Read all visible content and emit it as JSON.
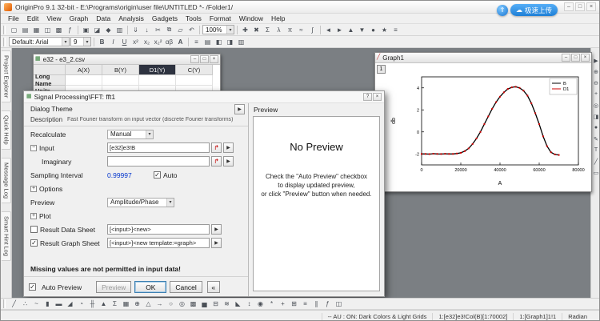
{
  "titlebar": {
    "app_title": "OriginPro 9.1 32-bit - E:\\Programs\\origin\\user file\\UNTITLED *- /Folder1/",
    "upload_button": "极速上传"
  },
  "menubar": {
    "items": [
      "File",
      "Edit",
      "View",
      "Graph",
      "Data",
      "Analysis",
      "Gadgets",
      "Tools",
      "Format",
      "Window",
      "Help"
    ]
  },
  "toolbar_main": {
    "zoom_value": "100%",
    "icons1": [
      {
        "name": "new-project-icon",
        "g": "▢"
      },
      {
        "name": "new-folder-icon",
        "g": "▤"
      },
      {
        "name": "new-workbook-icon",
        "g": "▦"
      },
      {
        "name": "new-graph-icon",
        "g": "◫"
      },
      {
        "name": "new-matrix-icon",
        "g": "▩"
      },
      {
        "name": "new-function-icon",
        "g": "ƒ"
      }
    ],
    "icons2": [
      {
        "name": "open-icon",
        "g": "▣"
      },
      {
        "name": "open-template-icon",
        "g": "◪"
      },
      {
        "name": "save-project-icon",
        "g": "◆"
      },
      {
        "name": "print-icon",
        "g": "▥"
      }
    ],
    "icons3": [
      {
        "name": "import-wizard-icon",
        "g": "⇓"
      },
      {
        "name": "import-ascii-icon",
        "g": "↓"
      },
      {
        "name": "cut-icon",
        "g": "✂"
      },
      {
        "name": "copy-icon",
        "g": "⧉"
      },
      {
        "name": "paste-icon",
        "g": "▱"
      },
      {
        "name": "undo-icon",
        "g": "↶"
      }
    ],
    "icons4": [
      {
        "name": "add-icon",
        "g": "✚"
      },
      {
        "name": "delete-icon",
        "g": "✖"
      },
      {
        "name": "sum-icon",
        "g": "Σ"
      },
      {
        "name": "script-icon",
        "g": "λ"
      },
      {
        "name": "symbol-icon",
        "g": "π"
      },
      {
        "name": "fit-icon",
        "g": "≈"
      },
      {
        "name": "integrate-icon",
        "g": "∫"
      }
    ],
    "icons5": [
      {
        "name": "prev-icon",
        "g": "◄"
      },
      {
        "name": "next-icon",
        "g": "►"
      },
      {
        "name": "up-icon",
        "g": "▲"
      },
      {
        "name": "down-icon",
        "g": "▼"
      },
      {
        "name": "record-icon",
        "g": "●"
      },
      {
        "name": "favorites-icon",
        "g": "★"
      },
      {
        "name": "list-icon",
        "g": "≡"
      }
    ]
  },
  "toolbar_format": {
    "font_combo": "Default: Arial",
    "size_combo": "9",
    "buttons": [
      {
        "name": "bold-button",
        "g": "B",
        "cls": "b"
      },
      {
        "name": "italic-button",
        "g": "I",
        "cls": "i"
      },
      {
        "name": "underline-button",
        "g": "U",
        "cls": "u"
      },
      {
        "name": "superscript-button",
        "g": "x²"
      },
      {
        "name": "subscript-button",
        "g": "x₂"
      },
      {
        "name": "subsuperscript-button",
        "g": "x₂²"
      },
      {
        "name": "greek-button",
        "g": "αβ"
      },
      {
        "name": "font-color-button",
        "g": "A",
        "cls": "b"
      }
    ],
    "icons": [
      {
        "name": "align-left-icon",
        "g": "≡"
      },
      {
        "name": "align-center-icon",
        "g": "▤"
      },
      {
        "name": "fill-color-icon",
        "g": "◧"
      },
      {
        "name": "border-icon",
        "g": "◨"
      },
      {
        "name": "style-icon",
        "g": "▥"
      }
    ]
  },
  "sidebar_left": {
    "tabs": [
      "Project Explorer",
      "Quick Help",
      "Message Log",
      "Smart Hint Log"
    ]
  },
  "right_toolbar": {
    "icons": [
      {
        "name": "pointer-tool-icon",
        "g": "▶"
      },
      {
        "name": "zoom-in-tool-icon",
        "g": "⊕"
      },
      {
        "name": "zoom-out-tool-icon",
        "g": "⊖"
      },
      {
        "name": "screen-reader-icon",
        "g": "+"
      },
      {
        "name": "data-reader-icon",
        "g": "◎"
      },
      {
        "name": "data-selector-icon",
        "g": "◨"
      },
      {
        "name": "mask-tool-icon",
        "g": "●"
      },
      {
        "name": "draw-tool-icon",
        "g": "✎"
      },
      {
        "name": "text-tool-icon",
        "g": "T"
      },
      {
        "name": "line-tool-icon",
        "g": "╱"
      },
      {
        "name": "rectangle-tool-icon",
        "g": "▭"
      }
    ]
  },
  "worksheet": {
    "title": "e32 - e3_2.csv",
    "columns": [
      {
        "label": "A(X)"
      },
      {
        "label": "B(Y)"
      },
      {
        "label": "D1(Y)",
        "cls": "selected"
      },
      {
        "label": "C(Y)"
      }
    ],
    "row_headers": [
      "Long Name",
      "Units"
    ]
  },
  "dialog": {
    "title": "Signal Processing\\FFT: fft1",
    "theme_label": "Dialog Theme",
    "description_label": "Description",
    "description_text": "Fast Fourier transform on input vector (discrete Fourier transforms)",
    "rows": {
      "recalculate": {
        "label": "Recalculate",
        "value": "Manual"
      },
      "input": {
        "label": "Input",
        "value": "[e32]e3!B"
      },
      "imaginary": {
        "label": "Imaginary",
        "value": ""
      },
      "sampling": {
        "label": "Sampling Interval",
        "value": "0.99997",
        "auto_label": "Auto"
      },
      "options": {
        "label": "Options"
      },
      "preview": {
        "label": "Preview",
        "value": "Amplitude/Phase"
      },
      "plot": {
        "label": "Plot"
      },
      "result_data": {
        "label": "Result Data Sheet",
        "value": "[<input>]<new>"
      },
      "result_graph": {
        "label": "Result Graph Sheet",
        "value": "[<input>]<new template:=graph>"
      }
    },
    "warning": "Missing values are not permitted in input data!",
    "buttons": {
      "auto_preview": "Auto Preview",
      "preview": "Preview",
      "ok": "OK",
      "cancel": "Cancel",
      "collapse": "«"
    }
  },
  "preview_panel": {
    "tab": "Preview",
    "heading": "No Preview",
    "line1": "Check the \"Auto Preview\" checkbox",
    "line2": "to display updated preview,",
    "line3": "or click \"Preview\" button when needed."
  },
  "graph_window": {
    "title": "Graph1",
    "layer": "1"
  },
  "chart_data": {
    "type": "line",
    "title": "",
    "xlabel": "A",
    "ylabel": "db",
    "xlim": [
      0,
      80000
    ],
    "ylim": [
      -3,
      5
    ],
    "xticks": [
      0,
      20000,
      40000,
      60000,
      80000
    ],
    "yticks": [
      -2,
      0,
      2,
      4
    ],
    "grid": false,
    "legend_position": "top-right",
    "x": [
      0,
      2000,
      4000,
      6000,
      8000,
      10000,
      12000,
      14000,
      16000,
      18000,
      20000,
      22000,
      24000,
      26000,
      28000,
      30000,
      32000,
      34000,
      36000,
      38000,
      40000,
      42000,
      44000,
      46000,
      48000,
      50000,
      52000,
      54000,
      56000,
      58000,
      60000,
      62000,
      64000,
      66000,
      68000,
      70000
    ],
    "series": [
      {
        "name": "B",
        "color": "#000000",
        "style": "line",
        "y": [
          -2,
          -2,
          -2.02,
          -1.98,
          -2,
          -2.01,
          -1.99,
          -2,
          -2,
          -1.97,
          -1.9,
          -1.75,
          -1.5,
          -1.1,
          -0.6,
          0,
          0.7,
          1.4,
          2.1,
          2.7,
          3.2,
          3.6,
          3.9,
          4.05,
          4.1,
          4,
          3.75,
          3.3,
          2.6,
          1.7,
          0.7,
          -0.4,
          -1.3,
          -1.85,
          -2.05,
          -2.1
        ]
      },
      {
        "name": "D1",
        "color": "#cc0000",
        "style": "marker",
        "y": [
          -2,
          -2,
          -2.02,
          -1.98,
          -2,
          -2.01,
          -1.99,
          -2,
          -2,
          -1.97,
          -1.9,
          -1.75,
          -1.5,
          -1.1,
          -0.6,
          0,
          0.7,
          1.4,
          2.1,
          2.7,
          3.2,
          3.6,
          3.9,
          4.05,
          4.1,
          4,
          3.75,
          3.3,
          2.6,
          1.7,
          0.7,
          -0.4,
          -1.3,
          -1.85,
          -2.05,
          -2.1
        ]
      }
    ]
  },
  "bottom_toolbar": {
    "icons": [
      {
        "name": "line-plot-icon",
        "g": "╱"
      },
      {
        "name": "scatter-plot-icon",
        "g": "∴"
      },
      {
        "name": "line-symbol-icon",
        "g": "~"
      },
      {
        "name": "column-chart-icon",
        "g": "▮"
      },
      {
        "name": "bar-chart-icon",
        "g": "▬"
      },
      {
        "name": "area-chart-icon",
        "g": "◢"
      },
      {
        "name": "pie-chart-icon",
        "g": "◔"
      },
      {
        "name": "double-y-icon",
        "g": "╫"
      },
      {
        "name": "3d-chart-icon",
        "g": "▲"
      },
      {
        "name": "statistics-chart-icon",
        "g": "Σ"
      },
      {
        "name": "template-icon",
        "g": "▦"
      },
      {
        "name": "polar-chart-icon",
        "g": "⊕"
      },
      {
        "name": "ternary-chart-icon",
        "g": "△"
      },
      {
        "name": "vector-chart-icon",
        "g": "→"
      },
      {
        "name": "bubble-chart-icon",
        "g": "○"
      },
      {
        "name": "contour-chart-icon",
        "g": "◎"
      },
      {
        "name": "heatmap-icon",
        "g": "▩"
      },
      {
        "name": "histogram-icon",
        "g": "▅"
      },
      {
        "name": "box-chart-icon",
        "g": "⊟"
      },
      {
        "name": "waterfall-icon",
        "g": "≋"
      },
      {
        "name": "fill-area-icon",
        "g": "◣"
      },
      {
        "name": "stock-chart-icon",
        "g": "↕"
      },
      {
        "name": "smith-chart-icon",
        "g": "◉"
      },
      {
        "name": "spider-chart-icon",
        "g": "*"
      },
      {
        "name": "zoom-chart-icon",
        "g": "+"
      },
      {
        "name": "multi-panel-icon",
        "g": "⊞"
      },
      {
        "name": "stack-chart-icon",
        "g": "≡"
      },
      {
        "name": "parallel-chart-icon",
        "g": "∥"
      },
      {
        "name": "function-plot-icon",
        "g": "ƒ"
      },
      {
        "name": "new-graph2-icon",
        "g": "◫"
      }
    ]
  },
  "statusbar": {
    "segments": [
      "-- AU : ON: Dark Colors & Light Grids",
      "1:[e32]e3!Col(B)[1:70002]",
      "1:[Graph1]1!1",
      "Radian"
    ]
  }
}
